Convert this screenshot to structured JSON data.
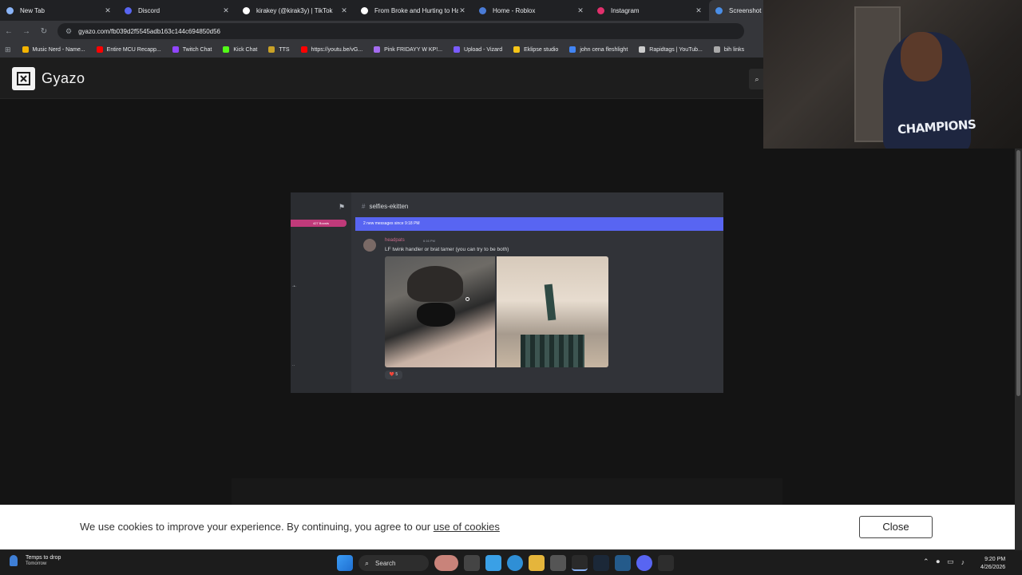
{
  "browser": {
    "tabs": [
      {
        "title": "New Tab",
        "icon": "chrome-icon",
        "color": "#8ab4f8"
      },
      {
        "title": "Discord",
        "icon": "discord-icon",
        "color": "#5865f2"
      },
      {
        "title": "kirakey (@kirak3y) | TikTok",
        "icon": "tiktok-icon",
        "color": "#ffffff"
      },
      {
        "title": "From Broke and Hurting to Ha",
        "icon": "tiktok-icon",
        "color": "#ffffff"
      },
      {
        "title": "Home - Roblox",
        "icon": "roblox-icon",
        "color": "#4a7bd6"
      },
      {
        "title": "Instagram",
        "icon": "instagram-icon",
        "color": "#e1306c"
      },
      {
        "title": "Screenshot",
        "icon": "gyazo-icon",
        "color": "#4a8ee6"
      }
    ],
    "close_glyph": "✕",
    "url": "gyazo.com/fb039d2f5545adb163c144c694850d56",
    "bookmarks": [
      {
        "label": "Music Nerd - Name...",
        "color": "#f4b400"
      },
      {
        "label": "Entire MCU Recapp...",
        "color": "#ff0000"
      },
      {
        "label": "Twitch Chat",
        "color": "#9146ff"
      },
      {
        "label": "Kick Chat",
        "color": "#53fc18"
      },
      {
        "label": "TTS",
        "color": "#c9a227"
      },
      {
        "label": "https://youtu.be/vG...",
        "color": "#ff0000"
      },
      {
        "label": "Pink FRIDAYY W KP!...",
        "color": "#a56cf0"
      },
      {
        "label": "Upload - Vizard",
        "color": "#7a5cff"
      },
      {
        "label": "Eklipse studio",
        "color": "#f5c518"
      },
      {
        "label": "john cena fleshlight",
        "color": "#4285f4"
      },
      {
        "label": "Rapidtags | YouTub...",
        "color": "#cccccc"
      },
      {
        "label": "bih links",
        "color": "#aaaaaa"
      }
    ]
  },
  "gyazo": {
    "logo_text": "Gyazo"
  },
  "screenshot": {
    "channel": "selfies-ekitten",
    "boost_label": "427 Boosts",
    "new_messages": "2 new messages since 9:18 PM",
    "username": "headpats",
    "time": "6:16 PM",
    "message": "LF twink handler or brat tamer (you can try to be both)",
    "reaction_count": "5",
    "reaction_emoji": "❤️"
  },
  "cookie": {
    "text": "We use cookies to improve your experience. By continuing, you agree to our ",
    "link": "use of cookies",
    "close_label": "Close"
  },
  "webcam": {
    "shirt_text": "CHAMPIONS"
  },
  "taskbar": {
    "weather_line1": "Temps to drop",
    "weather_line2": "Tomorrow",
    "search_label": "Search",
    "time": "9:20 PM",
    "date": "4/26/2026"
  }
}
